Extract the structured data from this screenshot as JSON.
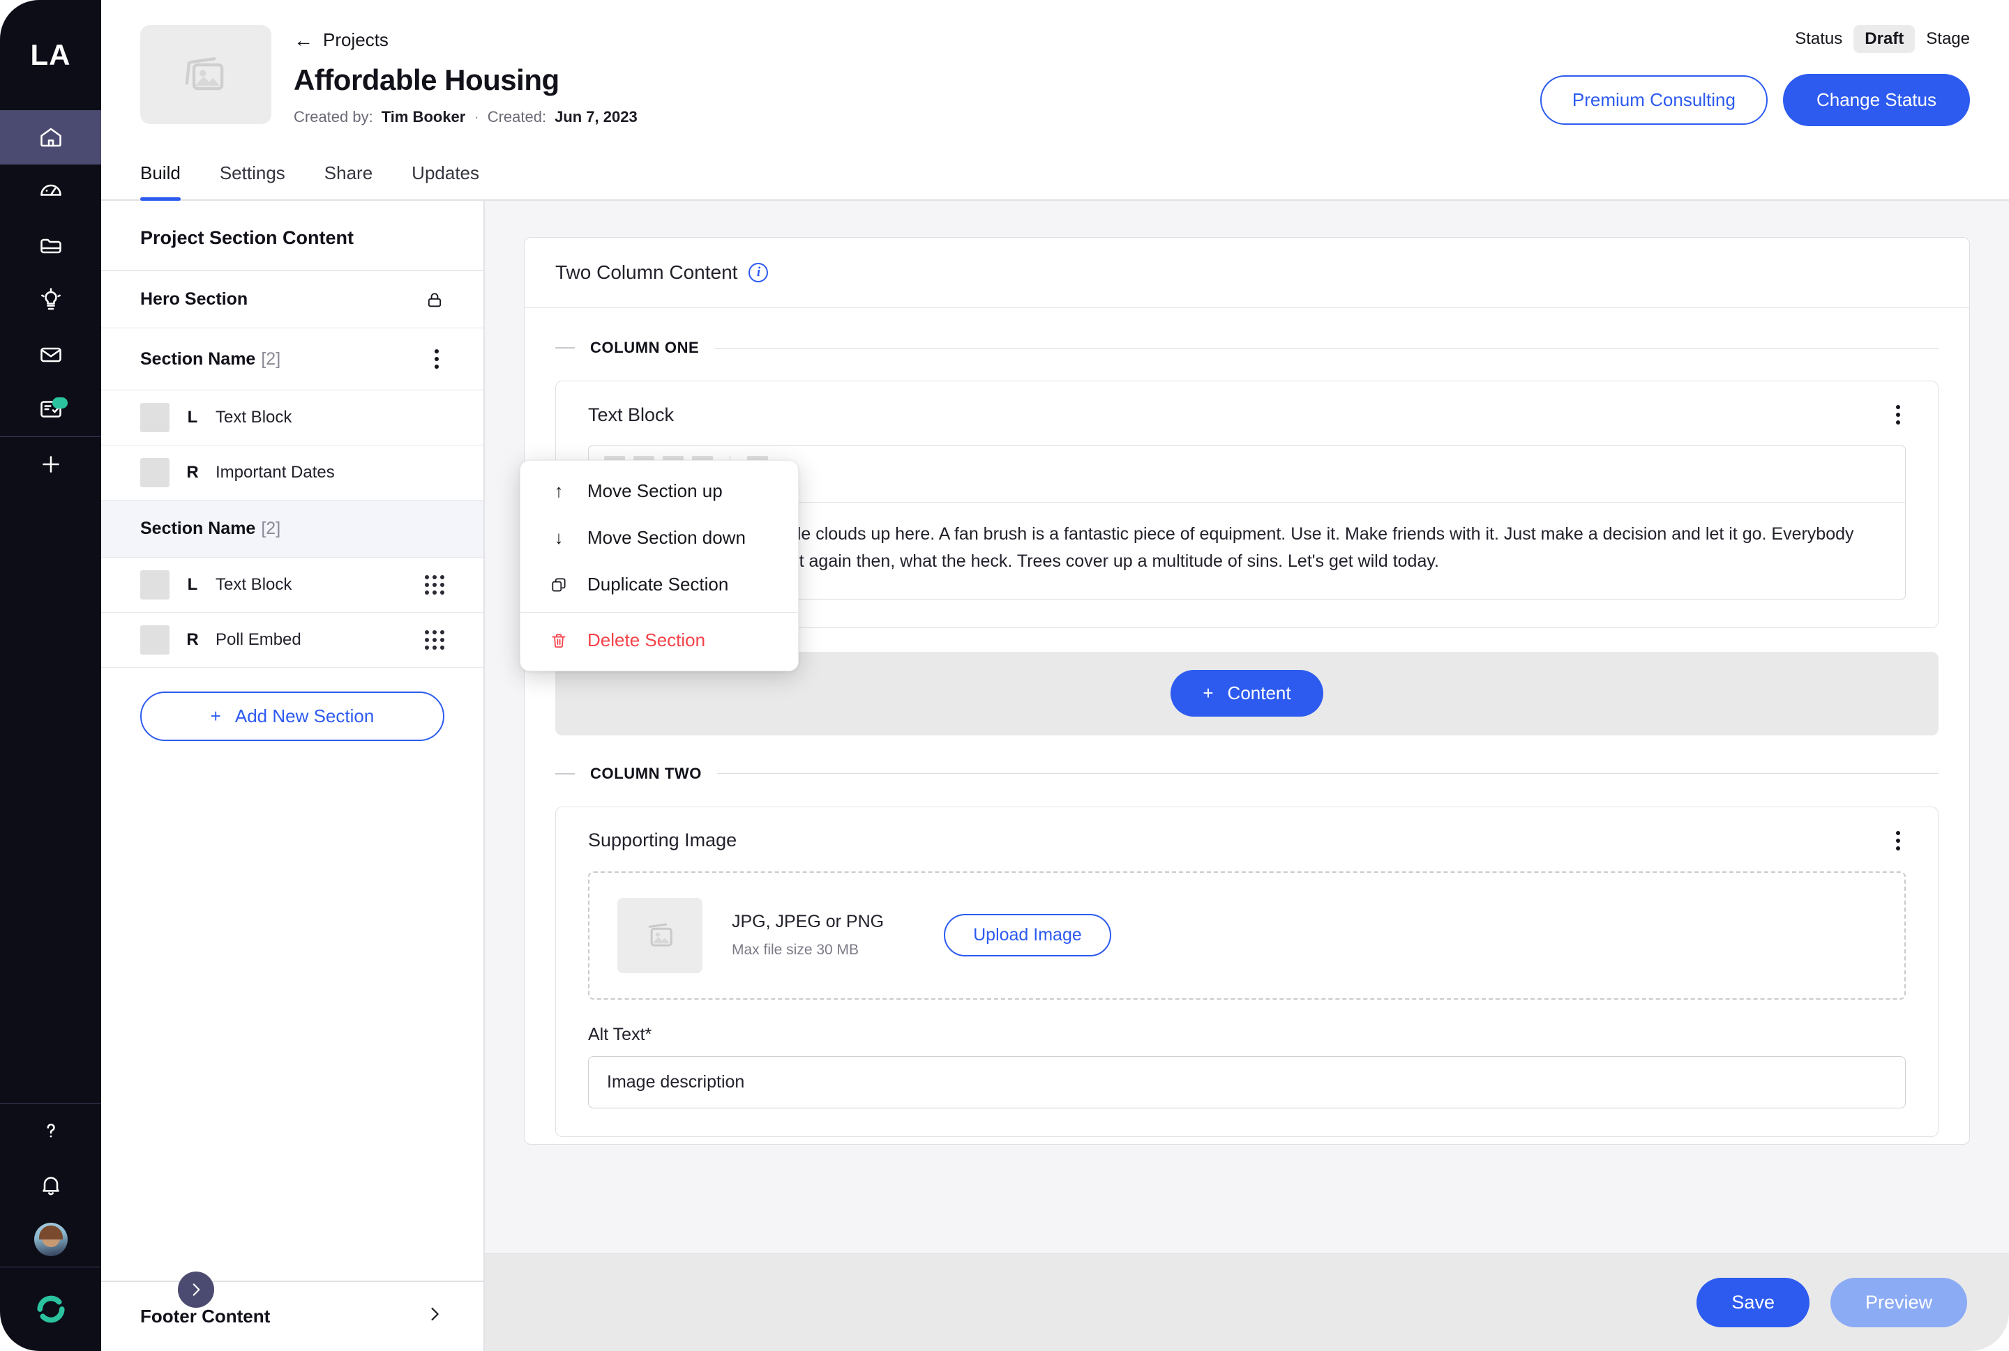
{
  "brand": {
    "logo_text": "LA",
    "accent": "#2d5bf0",
    "rail_bg": "#0d0d17",
    "active_bg": "#4b4a70",
    "badge": "#2bc2a0"
  },
  "rail": {
    "items": [
      {
        "name": "home-icon",
        "label": "Home"
      },
      {
        "name": "dashboard-icon",
        "label": "Dashboard"
      },
      {
        "name": "folder-icon",
        "label": "Projects"
      },
      {
        "name": "lightbulb-icon",
        "label": "Ideas"
      },
      {
        "name": "mail-icon",
        "label": "Messages"
      },
      {
        "name": "survey-icon",
        "label": "Surveys"
      }
    ],
    "add_label": "+",
    "bottom": [
      {
        "name": "help-icon",
        "label": "Help"
      },
      {
        "name": "bell-icon",
        "label": "Notifications"
      },
      {
        "name": "avatar",
        "label": "Profile"
      }
    ]
  },
  "header": {
    "breadcrumb": "Projects",
    "back_icon": "←",
    "title": "Affordable Housing",
    "created_by_label": "Created by:",
    "created_by": "Tim Booker",
    "separator": "·",
    "created_label": "Created:",
    "created_date": "Jun 7, 2023",
    "status_label": "Status",
    "status_value": "Draft",
    "stage_label": "Stage",
    "premium_button": "Premium Consulting",
    "change_status_button": "Change Status"
  },
  "tabs": [
    {
      "label": "Build",
      "active": true
    },
    {
      "label": "Settings",
      "active": false
    },
    {
      "label": "Share",
      "active": false
    },
    {
      "label": "Updates",
      "active": false
    }
  ],
  "panel": {
    "title": "Project Section Content",
    "hero": {
      "label": "Hero Section",
      "locked": true
    },
    "sections": [
      {
        "name": "Section Name",
        "count": "[2]",
        "selected": false,
        "blocks": [
          {
            "side": "L",
            "name": "Text Block"
          },
          {
            "side": "R",
            "name": "Important Dates"
          }
        ]
      },
      {
        "name": "Section Name",
        "count": "[2]",
        "selected": true,
        "blocks": [
          {
            "side": "L",
            "name": "Text Block"
          },
          {
            "side": "R",
            "name": "Poll Embed"
          }
        ]
      }
    ],
    "add_section_button": "Add New Section",
    "add_icon": "+",
    "footer_label": "Footer Content",
    "footer_chevron": "›"
  },
  "context_menu": {
    "items": [
      {
        "label": "Move Section up",
        "icon": "↑",
        "icon_name": "arrow-up-icon",
        "danger": false
      },
      {
        "label": "Move Section down",
        "icon": "↓",
        "icon_name": "arrow-down-icon",
        "danger": false
      },
      {
        "label": "Duplicate Section",
        "icon": "copy",
        "icon_name": "duplicate-icon",
        "danger": false
      },
      {
        "label": "Delete Section",
        "icon": "trash",
        "icon_name": "trash-icon",
        "danger": true
      }
    ]
  },
  "canvas": {
    "card_title": "Two Column Content",
    "column_one_label": "COLUMN ONE",
    "column_two_label": "COLUMN TWO",
    "text_block": {
      "title": "Text Block",
      "content": "Let's put some happy little clouds up here. A fan brush is a fantastic piece of equipment. Use it. Make friends with it. Just make a decision and let it go. Everybody needs a friend. Let's do it again then, what the heck. Trees cover up a multitude of sins. Let's get wild today."
    },
    "add_content_button": "Content",
    "add_content_icon": "+",
    "supporting_image": {
      "title": "Supporting Image",
      "formats": "JPG, JPEG or PNG",
      "max_size": "Max file size 30 MB",
      "upload_button": "Upload Image",
      "alt_text_label": "Alt Text*",
      "alt_text_placeholder": "Image description",
      "alt_text_value": ""
    }
  },
  "footer_bar": {
    "save_button": "Save",
    "preview_button": "Preview"
  }
}
